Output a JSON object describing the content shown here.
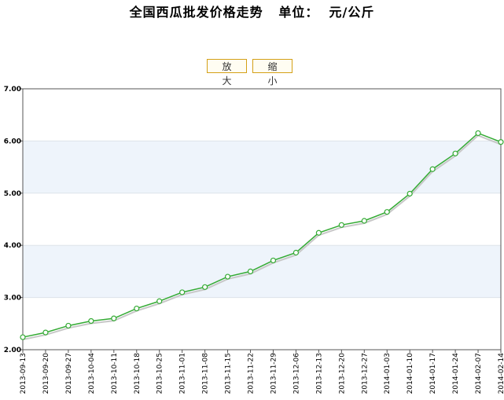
{
  "title": "全国西瓜批发价格走势   单位：  元/公斤",
  "controls": {
    "zoom_in": "放 大",
    "zoom_out": "缩 小"
  },
  "colors": {
    "line": "#33aa33",
    "band": "#eef4fb",
    "grid": "#dde3ea"
  },
  "chart_data": {
    "type": "line",
    "title": "全国西瓜批发价格走势   单位：  元/公斤",
    "xlabel": "",
    "ylabel": "",
    "ylim": [
      2.0,
      7.0
    ],
    "yticks": [
      "2.00",
      "3.00",
      "4.00",
      "5.00",
      "6.00",
      "7.00"
    ],
    "grid": true,
    "categories": [
      "2013-09-13",
      "2013-09-20",
      "2013-09-27",
      "2013-10-04",
      "2013-10-11",
      "2013-10-18",
      "2013-10-25",
      "2013-11-01",
      "2013-11-08",
      "2013-11-15",
      "2013-11-22",
      "2013-11-29",
      "2013-12-06",
      "2013-12-13",
      "2013-12-20",
      "2013-12-27",
      "2014-01-03",
      "2014-01-10",
      "2014-01-17",
      "2014-01-24",
      "2014-02-07",
      "2014-02-14"
    ],
    "series": [
      {
        "name": "",
        "values": [
          2.24,
          2.33,
          2.46,
          2.55,
          2.6,
          2.79,
          2.93,
          3.1,
          3.2,
          3.4,
          3.5,
          3.71,
          3.86,
          4.24,
          4.39,
          4.47,
          4.64,
          4.99,
          5.46,
          5.76,
          6.15,
          5.98
        ]
      }
    ]
  }
}
